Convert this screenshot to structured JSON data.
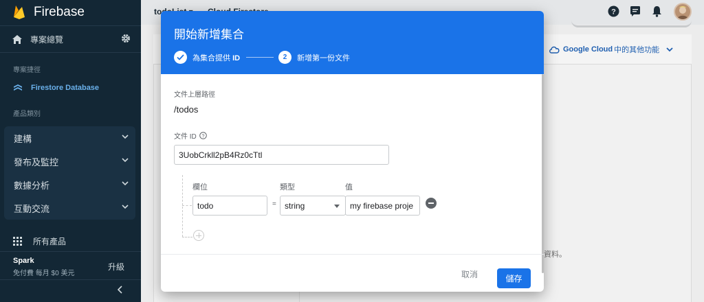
{
  "sidebar": {
    "brand": "Firebase",
    "overview_label": "專案總覽",
    "shortcuts_title": "專案捷徑",
    "firestore_label": "Firestore Database",
    "categories_title": "產品類別",
    "categories": [
      {
        "label": "建構"
      },
      {
        "label": "發布及監控"
      },
      {
        "label": "數據分析"
      },
      {
        "label": "互動交流"
      }
    ],
    "all_products_label": "所有產品",
    "plan_name": "Spark",
    "plan_price": "免付費 每月 $0 美元",
    "upgrade_label": "升級"
  },
  "topbar": {
    "project_name": "todoList ▾",
    "breadcrumb": "Cloud Firestore"
  },
  "background": {
    "gcloud_brand": "Google Cloud",
    "gcloud_rest": "中的其他功能",
    "tail_text": "資料。"
  },
  "dialog": {
    "title": "開始新增集合",
    "step1_prefix": "為集合提供",
    "step1_bold": "ID",
    "step2_number": "2",
    "step2_label": "新增第一份文件",
    "parent_path_label": "文件上層路徑",
    "parent_path_value": "/todos",
    "doc_id_label": "文件 ID",
    "doc_id_value": "3UobCrkll2pB4Rz0cTtl",
    "field_col_label": "欄位",
    "type_col_label": "類型",
    "value_col_label": "值",
    "field_name": "todo",
    "equals": "=",
    "field_type": "string",
    "field_value": "my firebase proje",
    "cancel_label": "取消",
    "save_label": "儲存"
  },
  "colors": {
    "accent": "#1a73e8",
    "sidebar_bg": "#132735",
    "firestore_active": "#6ab0ea"
  }
}
